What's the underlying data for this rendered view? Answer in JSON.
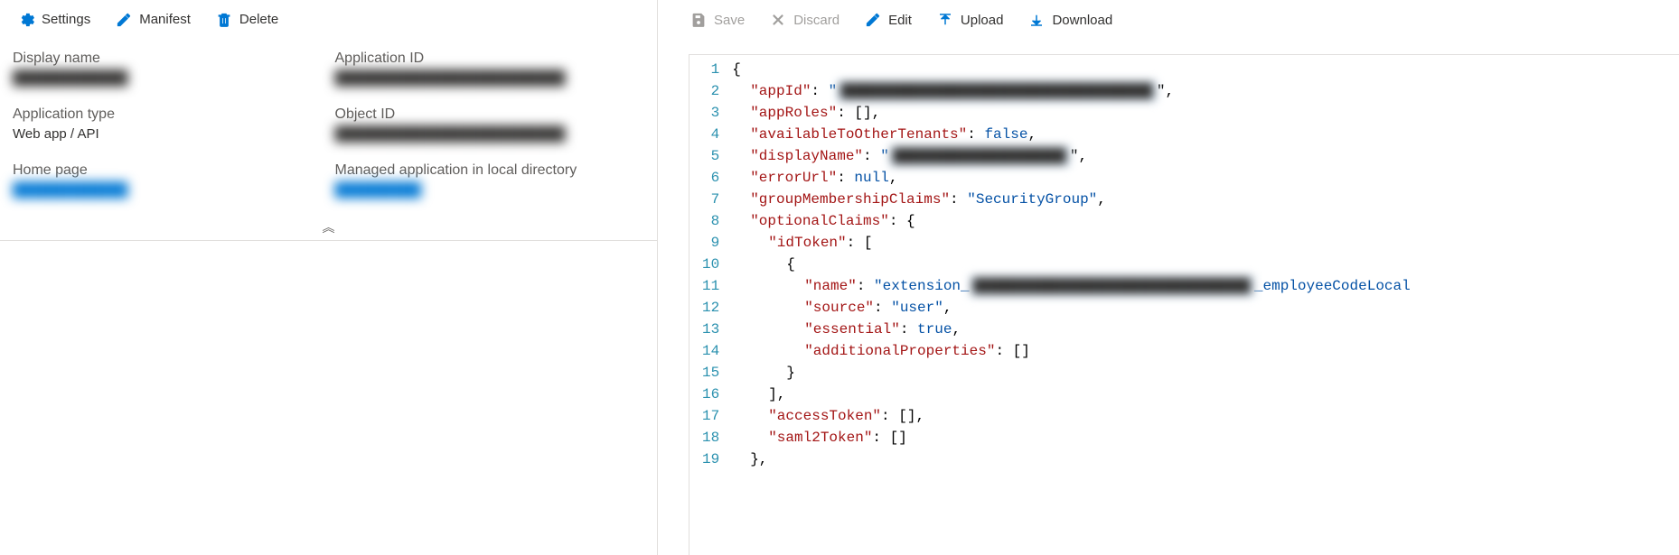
{
  "left_toolbar": {
    "settings_label": "Settings",
    "manifest_label": "Manifest",
    "delete_label": "Delete"
  },
  "right_toolbar": {
    "save_label": "Save",
    "discard_label": "Discard",
    "edit_label": "Edit",
    "upload_label": "Upload",
    "download_label": "Download"
  },
  "properties": [
    {
      "label": "Display name",
      "value": "████████████",
      "blur": true
    },
    {
      "label": "Application ID",
      "value": "████████████████████████",
      "blur": true
    },
    {
      "label": "Application type",
      "value": "Web app / API",
      "blur": false
    },
    {
      "label": "Object ID",
      "value": "████████████████████████",
      "blur": true
    },
    {
      "label": "Home page",
      "value": "████████████",
      "blur": true,
      "link": true
    },
    {
      "label": "Managed application in local directory",
      "value": "█████████",
      "blur": true,
      "link": true
    }
  ],
  "manifest": {
    "appId_hidden": "████████████████████████████████████",
    "displayName_hidden": "████████████████████",
    "ext_hidden": "████████████████████████████████",
    "lines": [
      {
        "n": 1,
        "depth": 0,
        "tokens": [
          [
            "punct",
            "{"
          ]
        ]
      },
      {
        "n": 2,
        "depth": 1,
        "tokens": [
          [
            "key",
            "\"appId\""
          ],
          [
            "punct",
            ": "
          ],
          [
            "str",
            "\""
          ],
          [
            "blur",
            "████████████████████████████████████"
          ],
          [
            "punct",
            "\","
          ]
        ]
      },
      {
        "n": 3,
        "depth": 1,
        "tokens": [
          [
            "key",
            "\"appRoles\""
          ],
          [
            "punct",
            ": [],"
          ]
        ]
      },
      {
        "n": 4,
        "depth": 1,
        "tokens": [
          [
            "key",
            "\"availableToOtherTenants\""
          ],
          [
            "punct",
            ": "
          ],
          [
            "bool",
            "false"
          ],
          [
            "punct",
            ","
          ]
        ]
      },
      {
        "n": 5,
        "depth": 1,
        "tokens": [
          [
            "key",
            "\"displayName\""
          ],
          [
            "punct",
            ": "
          ],
          [
            "str",
            "\""
          ],
          [
            "blur",
            "████████████████████"
          ],
          [
            "punct",
            "\","
          ]
        ]
      },
      {
        "n": 6,
        "depth": 1,
        "tokens": [
          [
            "key",
            "\"errorUrl\""
          ],
          [
            "punct",
            ": "
          ],
          [
            "null",
            "null"
          ],
          [
            "punct",
            ","
          ]
        ]
      },
      {
        "n": 7,
        "depth": 1,
        "tokens": [
          [
            "key",
            "\"groupMembershipClaims\""
          ],
          [
            "punct",
            ": "
          ],
          [
            "str",
            "\"SecurityGroup\""
          ],
          [
            "punct",
            ","
          ]
        ]
      },
      {
        "n": 8,
        "depth": 1,
        "tokens": [
          [
            "key",
            "\"optionalClaims\""
          ],
          [
            "punct",
            ": {"
          ]
        ]
      },
      {
        "n": 9,
        "depth": 2,
        "tokens": [
          [
            "key",
            "\"idToken\""
          ],
          [
            "punct",
            ": ["
          ]
        ]
      },
      {
        "n": 10,
        "depth": 3,
        "tokens": [
          [
            "punct",
            "{"
          ]
        ]
      },
      {
        "n": 11,
        "depth": 4,
        "tokens": [
          [
            "key",
            "\"name\""
          ],
          [
            "punct",
            ": "
          ],
          [
            "str",
            "\"extension_"
          ],
          [
            "blur",
            "████████████████████████████████"
          ],
          [
            "str",
            "_employeeCodeLocal"
          ]
        ]
      },
      {
        "n": 12,
        "depth": 4,
        "tokens": [
          [
            "key",
            "\"source\""
          ],
          [
            "punct",
            ": "
          ],
          [
            "str",
            "\"user\""
          ],
          [
            "punct",
            ","
          ]
        ]
      },
      {
        "n": 13,
        "depth": 4,
        "tokens": [
          [
            "key",
            "\"essential\""
          ],
          [
            "punct",
            ": "
          ],
          [
            "bool",
            "true"
          ],
          [
            "punct",
            ","
          ]
        ]
      },
      {
        "n": 14,
        "depth": 4,
        "tokens": [
          [
            "key",
            "\"additionalProperties\""
          ],
          [
            "punct",
            ": []"
          ]
        ]
      },
      {
        "n": 15,
        "depth": 3,
        "tokens": [
          [
            "punct",
            "}"
          ]
        ]
      },
      {
        "n": 16,
        "depth": 2,
        "tokens": [
          [
            "punct",
            "],"
          ]
        ]
      },
      {
        "n": 17,
        "depth": 2,
        "tokens": [
          [
            "key",
            "\"accessToken\""
          ],
          [
            "punct",
            ": [],"
          ]
        ]
      },
      {
        "n": 18,
        "depth": 2,
        "tokens": [
          [
            "key",
            "\"saml2Token\""
          ],
          [
            "punct",
            ": []"
          ]
        ]
      },
      {
        "n": 19,
        "depth": 1,
        "tokens": [
          [
            "punct",
            "},"
          ]
        ]
      }
    ]
  }
}
